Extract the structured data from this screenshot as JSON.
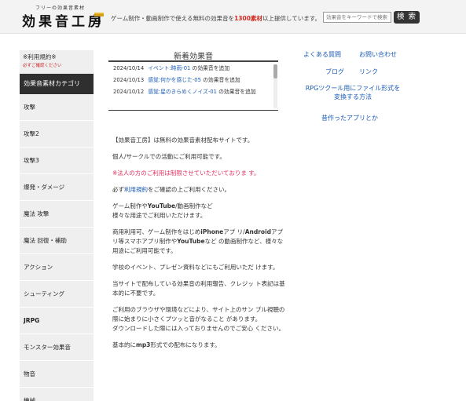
{
  "header": {
    "logo_sub": "フリーの効果音素材",
    "logo": "効果音工房",
    "tagline_pre": "ゲーム制作・動画制作で使える無料の効果音を",
    "tagline_count": "1300素材",
    "tagline_post": "以上提供しています。",
    "search_placeholder": "効果音をキーワードで検索",
    "search_button": "検 索"
  },
  "sidebar": {
    "notice_line1": "※利用規約※",
    "notice_line2": "必ずご確認ください",
    "category_title": "効果音素材カテゴリ",
    "items": [
      {
        "label": "攻撃"
      },
      {
        "label": "攻撃2"
      },
      {
        "label": "攻撃3"
      },
      {
        "label": "爆発・ダメージ"
      },
      {
        "label": "魔法 攻撃"
      },
      {
        "label": "魔法 回復・補助"
      },
      {
        "label": "アクション"
      },
      {
        "label": "シューティング"
      },
      {
        "label": "JRPG"
      },
      {
        "label": "モンスター効果音"
      },
      {
        "label": "物音"
      },
      {
        "label": "機械"
      }
    ]
  },
  "news": {
    "title": "新着効果音",
    "items": [
      {
        "date": "2024/10/14",
        "link": "イベント:時雨-01",
        "suffix": "の効果音を追加"
      },
      {
        "date": "2024/10/13",
        "link": "感覚:何かを感じた-05",
        "suffix": "の効果音を追加"
      },
      {
        "date": "2024/10/12",
        "link": "感覚:星のきらめくノイズ-01",
        "suffix": "の効果音を追加"
      }
    ]
  },
  "right_nav": {
    "faq": "よくある質問",
    "contact": "お問い合わせ",
    "blog": "ブログ",
    "links": "リンク",
    "rpg_line1": "RPGツクール用にファイル形式を",
    "rpg_line2": "変換する方法",
    "apps": "昔作ったアプリとか"
  },
  "content": {
    "p1": "【効果音工房】は無料の効果音素材配布サイトです。",
    "p2": "個人/サークルでの活動にご利用可能です。",
    "p3": "※法人の方のご利用は制限させていただいておりま す。",
    "p4_pre": "必ず",
    "p4_link": "利用規約",
    "p4_post": "をご確認の上ご利用ください。",
    "p5_a": "ゲーム制作や",
    "p5_b": "YouTube",
    "p5_c": "/動画制作など",
    "p5_d": "様々な用途でご利用いただけます。",
    "p6_a": "商用利用可、ゲーム制作をはじめ",
    "p6_b": "iPhone",
    "p6_c": "アプ リ/",
    "p6_d": "Android",
    "p6_e": "アプリ等スマホアプリ制作や",
    "p6_f": "YouTube",
    "p6_g": "など の動画制作など、様々な用途にご利用可能です。",
    "p7": "学校のイベント、プレゼン資料などにもご利用いただ けます。",
    "p8": "当サイトで配布している効果音の利用報告、クレジッ ト表記は基本的に不要です。",
    "p9": "ご利用のブラウザや環境などにより、サイト上のサン プル視聴の際に始まりに小さくプツッと音がなること があります。",
    "p10": "ダウンロードした際には入っておりませんのでご安心 ください。",
    "p11_a": "基本的に",
    "p11_b": "mp3",
    "p11_c": "形式での配布になります。"
  }
}
